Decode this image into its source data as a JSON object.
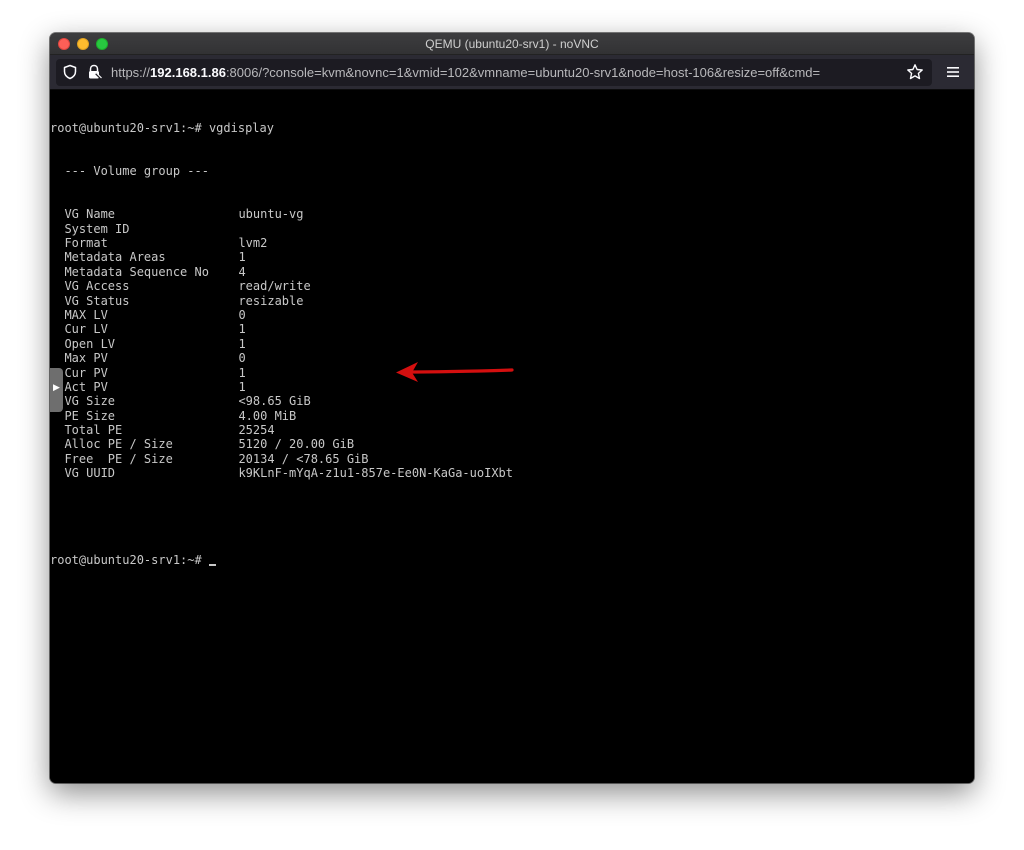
{
  "window": {
    "title": "QEMU (ubuntu20-srv1) - noVNC"
  },
  "browser": {
    "url_prefix": "https://",
    "url_host": "192.168.1.86",
    "url_rest": ":8006/?console=kvm&novnc=1&vmid=102&vmname=ubuntu20-srv1&node=host-106&resize=off&cmd="
  },
  "console": {
    "prompt_line": "root@ubuntu20-srv1:~# vgdisplay",
    "header": "  --- Volume group ---",
    "rows": [
      {
        "key": "VG Name",
        "value": "ubuntu-vg"
      },
      {
        "key": "System ID",
        "value": ""
      },
      {
        "key": "Format",
        "value": "lvm2"
      },
      {
        "key": "Metadata Areas",
        "value": "1"
      },
      {
        "key": "Metadata Sequence No",
        "value": "4"
      },
      {
        "key": "VG Access",
        "value": "read/write"
      },
      {
        "key": "VG Status",
        "value": "resizable"
      },
      {
        "key": "MAX LV",
        "value": "0"
      },
      {
        "key": "Cur LV",
        "value": "1"
      },
      {
        "key": "Open LV",
        "value": "1"
      },
      {
        "key": "Max PV",
        "value": "0"
      },
      {
        "key": "Cur PV",
        "value": "1"
      },
      {
        "key": "Act PV",
        "value": "1"
      },
      {
        "key": "VG Size",
        "value": "<98.65 GiB"
      },
      {
        "key": "PE Size",
        "value": "4.00 MiB"
      },
      {
        "key": "Total PE",
        "value": "25254"
      },
      {
        "key": "Alloc PE / Size",
        "value": "5120 / 20.00 GiB"
      },
      {
        "key": "Free  PE / Size",
        "value": "20134 / <78.65 GiB"
      },
      {
        "key": "VG UUID",
        "value": "k9KLnF-mYqA-z1u1-857e-Ee0N-KaGa-uoIXbt"
      }
    ],
    "final_prompt": "root@ubuntu20-srv1:~# "
  },
  "colors": {
    "annotation_arrow": "#d40f0f",
    "terminal_text": "#c8c8c8",
    "terminal_bg": "#000000"
  },
  "icons": [
    "shield-icon",
    "lock-icon",
    "star-icon",
    "menu-icon",
    "arrow-annotation-icon"
  ]
}
